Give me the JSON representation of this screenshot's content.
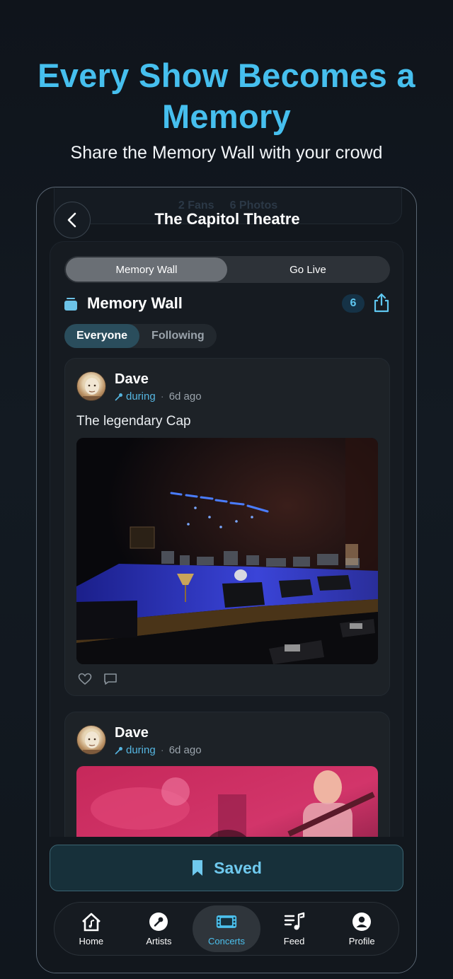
{
  "hero": {
    "title": "Every Show Becomes a Memory",
    "subtitle": "Share the Memory Wall with your crowd"
  },
  "stats_ghost": {
    "fans": "2 Fans",
    "photos": "6 Photos"
  },
  "header": {
    "title": "The Capitol Theatre"
  },
  "segment": {
    "options": [
      "Memory Wall",
      "Go Live"
    ],
    "selected": "Memory Wall"
  },
  "wall": {
    "title": "Memory Wall",
    "count": "6"
  },
  "filter": {
    "options": [
      "Everyone",
      "Following"
    ],
    "selected": "Everyone"
  },
  "posts": [
    {
      "author": "Dave",
      "when": "during",
      "ago": "6d ago",
      "caption": "The legendary Cap"
    },
    {
      "author": "Dave",
      "when": "during",
      "ago": "6d ago"
    }
  ],
  "saved": {
    "label": "Saved"
  },
  "tabs": [
    {
      "label": "Home",
      "icon": "home-icon"
    },
    {
      "label": "Artists",
      "icon": "microphone-icon"
    },
    {
      "label": "Concerts",
      "icon": "ticket-icon"
    },
    {
      "label": "Feed",
      "icon": "music-list-icon"
    },
    {
      "label": "Profile",
      "icon": "person-icon"
    }
  ],
  "colors": {
    "accent": "#46bfee",
    "background": "#12171d",
    "active_tab": "#4cc1ee"
  }
}
